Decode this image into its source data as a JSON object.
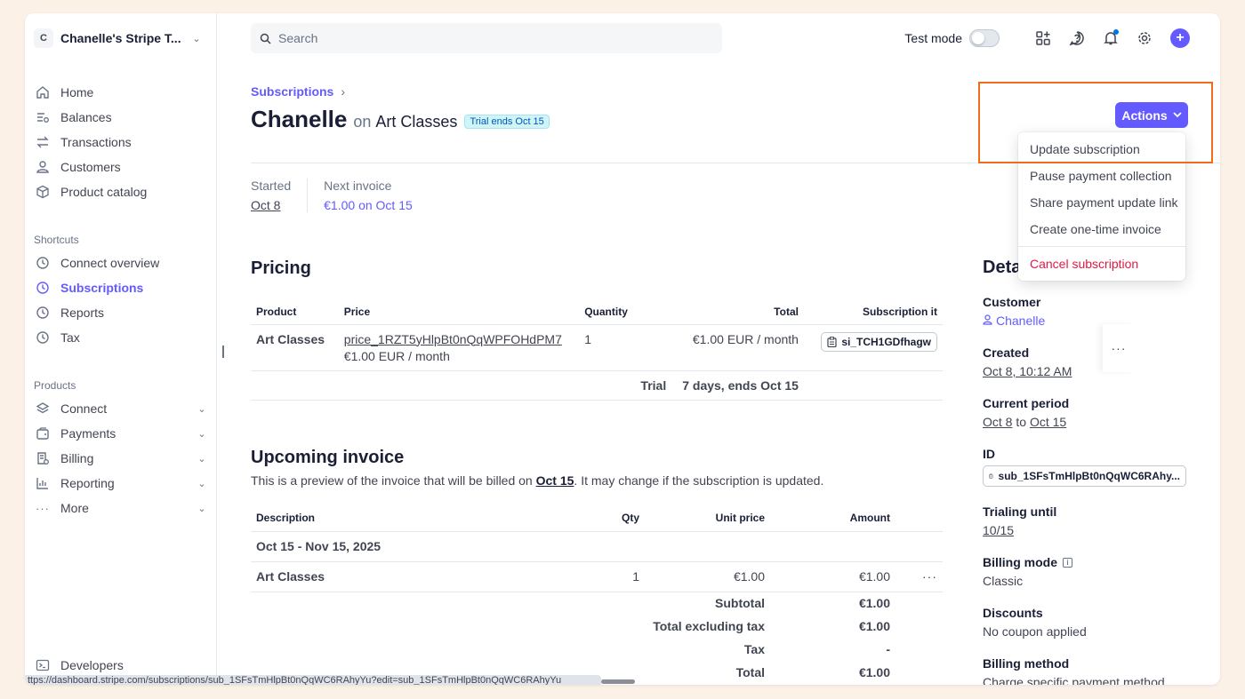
{
  "account": {
    "badge": "C",
    "name": "Chanelle's Stripe T..."
  },
  "nav_main": [
    {
      "label": "Home",
      "icon": "home-icon"
    },
    {
      "label": "Balances",
      "icon": "balances-icon"
    },
    {
      "label": "Transactions",
      "icon": "transactions-icon"
    },
    {
      "label": "Customers",
      "icon": "customers-icon"
    },
    {
      "label": "Product catalog",
      "icon": "product-catalog-icon"
    }
  ],
  "shortcuts": {
    "label": "Shortcuts",
    "items": [
      {
        "label": "Connect overview",
        "icon": "clock-icon"
      },
      {
        "label": "Subscriptions",
        "icon": "clock-icon",
        "active": true
      },
      {
        "label": "Reports",
        "icon": "clock-icon"
      },
      {
        "label": "Tax",
        "icon": "clock-icon"
      }
    ]
  },
  "products": {
    "label": "Products",
    "items": [
      {
        "label": "Connect",
        "icon": "connect-icon"
      },
      {
        "label": "Payments",
        "icon": "payments-icon"
      },
      {
        "label": "Billing",
        "icon": "billing-icon"
      },
      {
        "label": "Reporting",
        "icon": "reporting-icon"
      },
      {
        "label": "More",
        "icon": "more-icon"
      }
    ]
  },
  "developers": {
    "label": "Developers"
  },
  "topbar": {
    "search_placeholder": "Search",
    "test_mode_label": "Test mode",
    "test_mode_on": false
  },
  "page": {
    "breadcrumb": "Subscriptions",
    "customer_name": "Chanelle",
    "on_word": "on",
    "product_name": "Art Classes",
    "trial_badge": "Trial ends Oct 15",
    "started_label": "Started",
    "started_value": "Oct 8",
    "next_invoice_label": "Next invoice",
    "next_invoice_value": "€1.00 on Oct 15"
  },
  "pricing": {
    "heading": "Pricing",
    "columns": [
      "Product",
      "Price",
      "Quantity",
      "Total",
      "Subscription it"
    ],
    "row": {
      "product": "Art Classes",
      "price_id": "price_1RZT5yHlpBt0nQqWPFOHdPM7",
      "price_desc": "€1.00 EUR / month",
      "quantity": "1",
      "total": "€1.00 EUR / month",
      "subscription_item": "si_TCH1GDfhagw"
    },
    "trial_label": "Trial",
    "trial_value": "7 days, ends Oct 15"
  },
  "upcoming": {
    "heading": "Upcoming invoice",
    "desc_prefix": "This is a preview of the invoice that will be billed on ",
    "desc_date": "Oct 15",
    "desc_suffix": ". It may change if the subscription is updated.",
    "columns": [
      "Description",
      "Qty",
      "Unit price",
      "Amount"
    ],
    "period": "Oct 15 - Nov 15, 2025",
    "line": {
      "description": "Art Classes",
      "qty": "1",
      "unit_price": "€1.00",
      "amount": "€1.00"
    },
    "totals": [
      {
        "label": "Subtotal",
        "value": "€1.00"
      },
      {
        "label": "Total excluding tax",
        "value": "€1.00"
      },
      {
        "label": "Tax",
        "value": "-"
      },
      {
        "label": "Total",
        "value": "€1.00"
      }
    ]
  },
  "details": {
    "heading": "Deta",
    "customer_label": "Customer",
    "customer_value": "Chanelle",
    "created_label": "Created",
    "created_value": "Oct 8, 10:12 AM",
    "period_label": "Current period",
    "period_start": "Oct 8",
    "period_to": "to",
    "period_end": "Oct 15",
    "id_label": "ID",
    "id_value": "sub_1SFsTmHlpBt0nQqWC6RAhy...",
    "trialing_label": "Trialing until",
    "trialing_value": "10/15",
    "billing_mode_label": "Billing mode",
    "billing_mode_value": "Classic",
    "discounts_label": "Discounts",
    "discounts_value": "No coupon applied",
    "billing_method_label": "Billing method",
    "billing_method_value": "Charge specific payment method"
  },
  "actions": {
    "button_label": "Actions",
    "menu": [
      {
        "label": "Update subscription"
      },
      {
        "label": "Pause payment collection"
      },
      {
        "label": "Share payment update link"
      },
      {
        "label": "Create one-time invoice"
      },
      {
        "label": "Cancel subscription",
        "danger": true
      }
    ]
  },
  "status_url": "ttps://dashboard.stripe.com/subscriptions/sub_1SFsTmHlpBt0nQqWC6RAhyYu?edit=sub_1SFsTmHlpBt0nQqWC6RAhyYu",
  "colors": {
    "accent": "#635bff",
    "danger": "#df1b41",
    "highlight": "#ef6c1a",
    "background": "#fcf1e6"
  }
}
